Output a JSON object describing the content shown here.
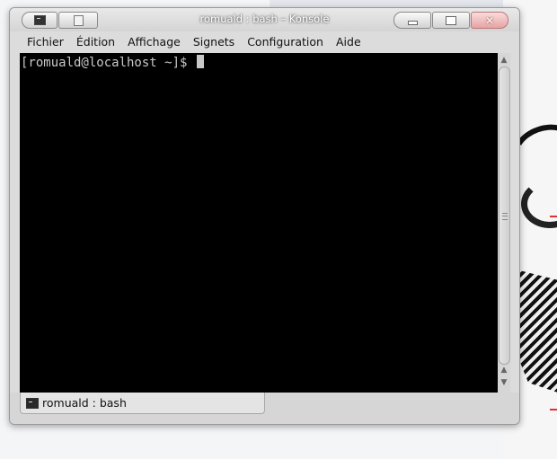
{
  "window": {
    "title": "romuald : bash – Konsole"
  },
  "menubar": {
    "items": [
      "Fichier",
      "Édition",
      "Affichage",
      "Signets",
      "Configuration",
      "Aide"
    ]
  },
  "terminal": {
    "prompt": "[romuald@localhost ~]$ "
  },
  "tabs": [
    {
      "label": "romuald : bash",
      "icon": "terminal-icon"
    }
  ],
  "titlebar": {
    "left_buttons": [
      "terminal-menu-icon",
      "keep-above-icon"
    ],
    "right_buttons": [
      "minimize-icon",
      "maximize-icon",
      "close-icon"
    ]
  },
  "colors": {
    "terminal_bg": "#000000",
    "terminal_fg": "#c8c8c8",
    "close_button": "#e6a3a3"
  }
}
